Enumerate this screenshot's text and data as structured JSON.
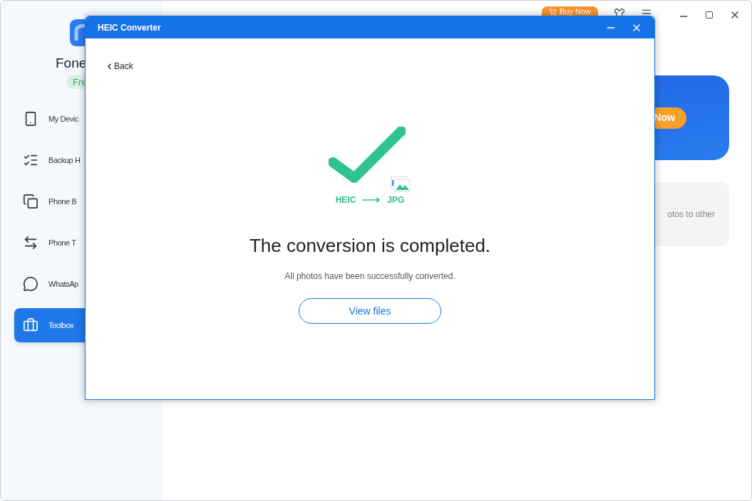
{
  "app": {
    "name": "Fone",
    "badge": "Fre",
    "buy_button": "Buy Now"
  },
  "sidebar": {
    "items": [
      {
        "label": "My Devic",
        "kind": "phone",
        "selected": false
      },
      {
        "label": "Backup H",
        "kind": "list",
        "selected": false
      },
      {
        "label": "Phone B",
        "kind": "copy",
        "selected": false
      },
      {
        "label": "Phone T",
        "kind": "transfer",
        "selected": false
      },
      {
        "label": "WhatsAp",
        "kind": "chat",
        "selected": false
      },
      {
        "label": "Toolbox",
        "kind": "toolbox",
        "selected": true
      }
    ]
  },
  "banner": {
    "button": "Now"
  },
  "card": {
    "text": "otos to other"
  },
  "dialog": {
    "title": "HEIC Converter",
    "back": "Back",
    "from_format": "HEIC",
    "to_format": "JPG",
    "heading": "The conversion is completed.",
    "message": "All photos have been successfully converted.",
    "button": "View files"
  }
}
